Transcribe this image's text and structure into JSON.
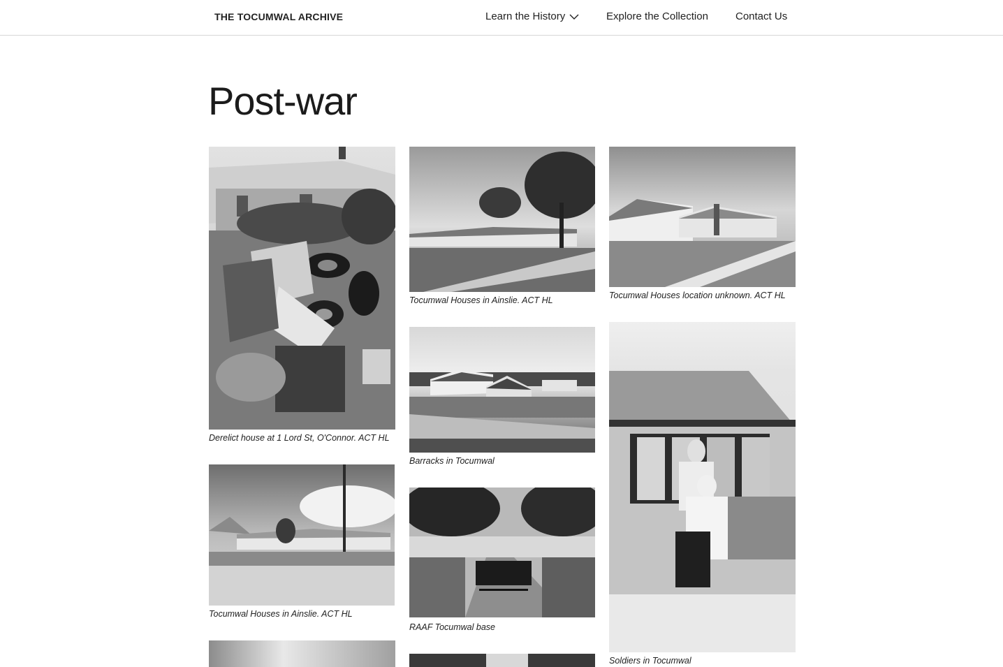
{
  "header": {
    "brand": "THE TOCUMWAL ARCHIVE",
    "nav": [
      {
        "label": "Learn the History",
        "has_dropdown": true
      },
      {
        "label": "Explore the Collection"
      },
      {
        "label": "Contact Us"
      }
    ]
  },
  "page": {
    "title": "Post-war"
  },
  "gallery": [
    {
      "caption": "Derelict house at 1 Lord St, O'Connor. ACT HL"
    },
    {
      "caption": "Tocumwal Houses in Ainslie. ACT HL"
    },
    {
      "caption": "Tocumwal Houses location unknown. ACT HL"
    },
    {
      "caption": "Barracks in Tocumwal"
    },
    {
      "caption": "Tocumwal Houses in Ainslie. ACT HL"
    },
    {
      "caption": "RAAF Tocumwal base"
    },
    {
      "caption": "Soldiers in Tocumwal"
    },
    {
      "caption": ""
    },
    {
      "caption": ""
    }
  ]
}
